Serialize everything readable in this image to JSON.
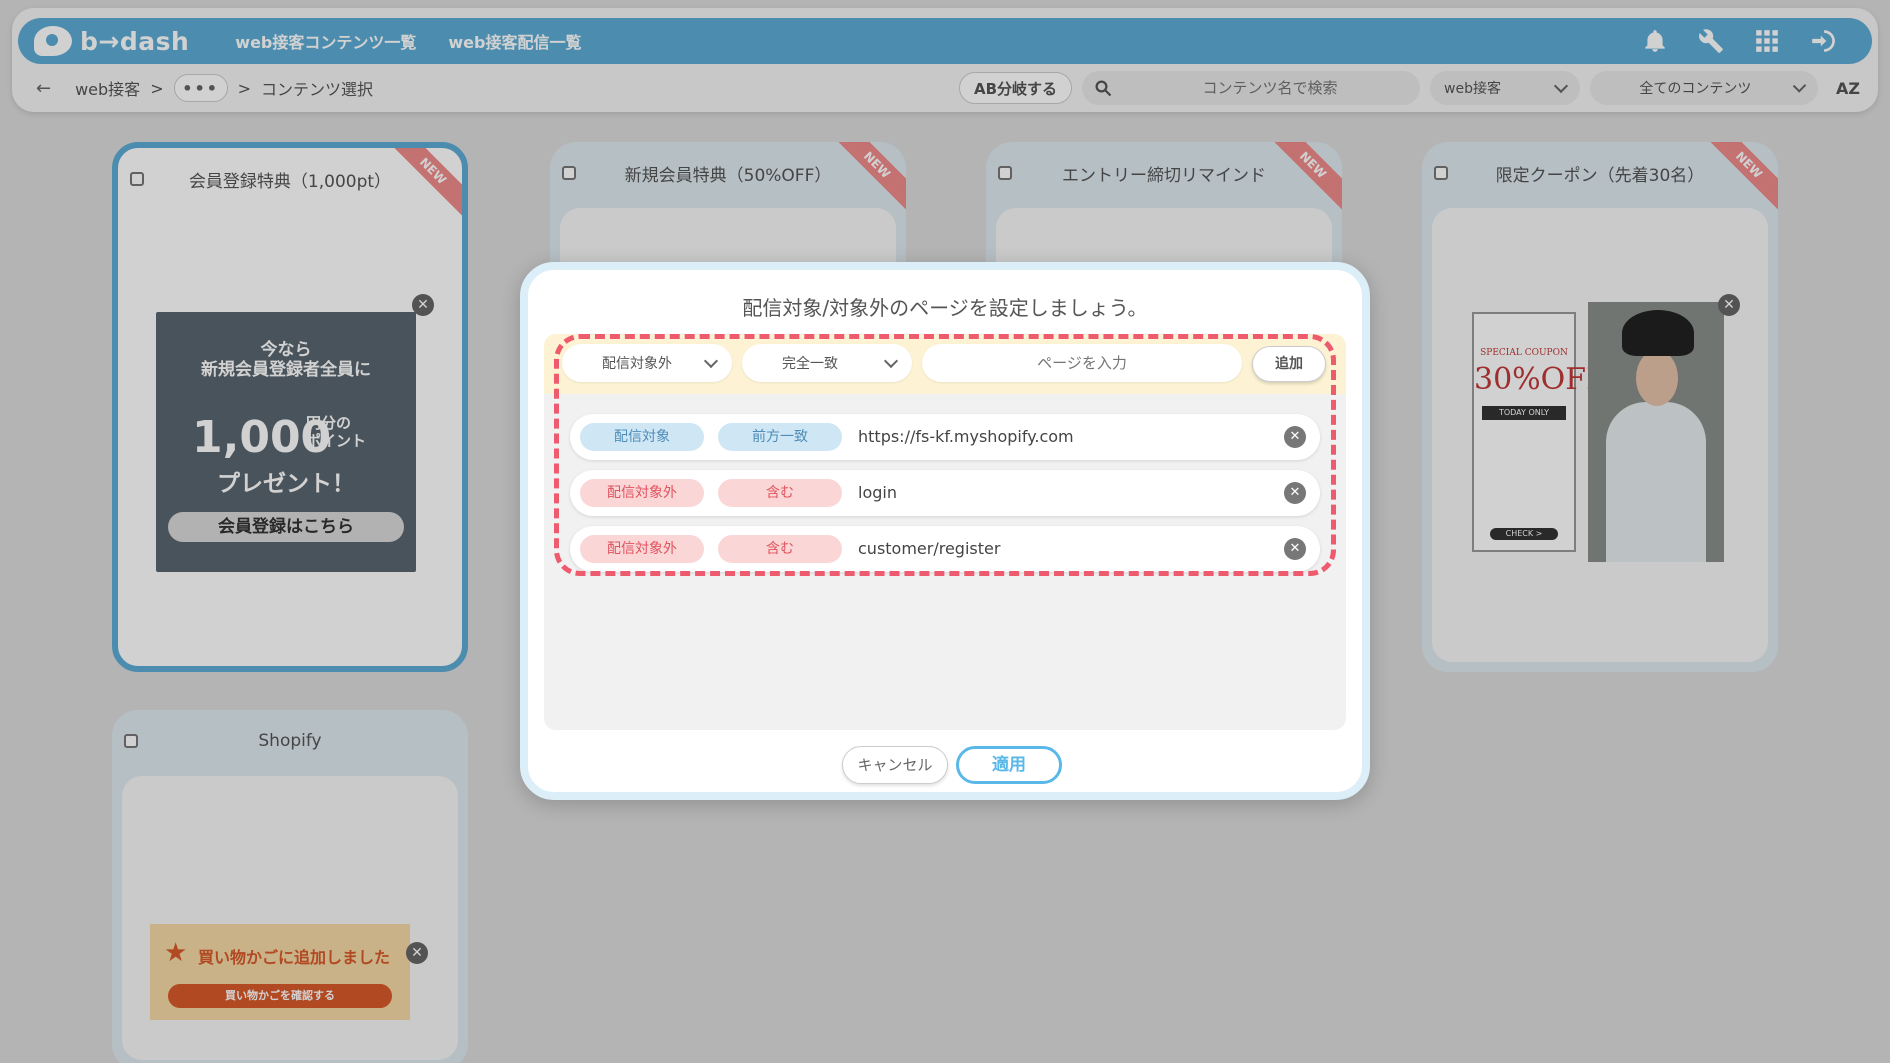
{
  "topbar": {
    "logo_text": "b→dash",
    "nav": [
      "web接客コンテンツ一覧",
      "web接客配信一覧"
    ],
    "icons": [
      "bell-icon",
      "wrench-icon",
      "grid-icon",
      "logout-icon"
    ]
  },
  "subbar": {
    "back": "←",
    "breadcrumb_root": "web接客",
    "sep": ">",
    "dots": "•••",
    "breadcrumb_current": "コンテンツ選択",
    "ab_button": "AB分岐する",
    "search_placeholder": "コンテンツ名で検索",
    "filter_type": "web接客",
    "filter_content": "全てのコンテンツ",
    "sort": "AZ"
  },
  "cards": [
    {
      "title": "会員登録特典（1,000pt）",
      "new": "NEW"
    },
    {
      "title": "新規会員特典（50%OFF）",
      "new": "NEW"
    },
    {
      "title": "エントリー締切リマインド",
      "new": "NEW"
    },
    {
      "title": "限定クーポン（先着30名）",
      "new": "NEW"
    },
    {
      "title": "Shopify"
    }
  ],
  "creative_member": {
    "line1": "今なら",
    "line2": "新規会員登録者全員に",
    "amount": "1,000",
    "unit1": "円分の",
    "unit2": "ポイント",
    "present": "プレゼント！",
    "cta": "会員登録はこちら"
  },
  "creative_coupon": {
    "head": "SPECIAL COUPON",
    "percent": "30%OFF",
    "today": "TODAY ONLY",
    "check": "CHECK >"
  },
  "creative_cart": {
    "title": "買い物かごに追加しました",
    "button": "買い物かごを確認する"
  },
  "modal": {
    "title": "配信対象/対象外のページを設定しましょう。",
    "target_select": "配信対象外",
    "match_select": "完全一致",
    "page_placeholder": "ページを入力",
    "add_button": "追加",
    "rules": [
      {
        "type": "配信対象",
        "match": "前方一致",
        "value": "https://fs-kf.myshopify.com",
        "color": "blue"
      },
      {
        "type": "配信対象外",
        "match": "含む",
        "value": "login",
        "color": "red"
      },
      {
        "type": "配信対象外",
        "match": "含む",
        "value": "customer/register",
        "color": "red"
      }
    ],
    "cancel": "キャンセル",
    "apply": "適用"
  },
  "colors": {
    "brand_blue": "#5dadd6",
    "highlight_dash": "#ee5b6f",
    "apply_blue": "#5ab8e8"
  }
}
